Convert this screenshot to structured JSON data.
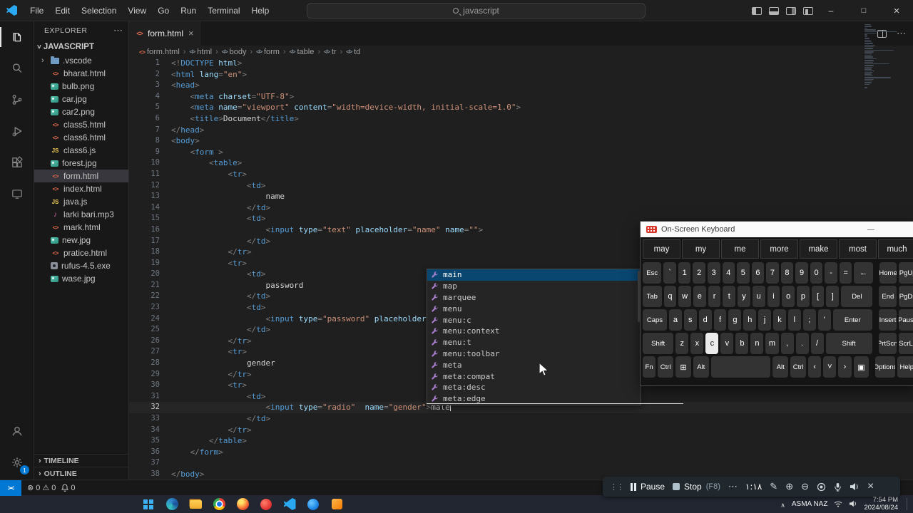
{
  "titlebar": {
    "menus": [
      "File",
      "Edit",
      "Selection",
      "View",
      "Go",
      "Run",
      "Terminal",
      "Help"
    ],
    "search": "javascript"
  },
  "activity_bar": {
    "settings_badge": "1"
  },
  "explorer": {
    "title": "EXPLORER",
    "root": "JAVASCRIPT",
    "files": [
      {
        "name": ".vscode",
        "type": "folder"
      },
      {
        "name": "bharat.html",
        "type": "html"
      },
      {
        "name": "bulb.png",
        "type": "img"
      },
      {
        "name": "car.jpg",
        "type": "img"
      },
      {
        "name": "car2.png",
        "type": "img"
      },
      {
        "name": "class5.html",
        "type": "html"
      },
      {
        "name": "class6.html",
        "type": "html"
      },
      {
        "name": "class6.js",
        "type": "js"
      },
      {
        "name": "forest.jpg",
        "type": "img"
      },
      {
        "name": "form.html",
        "type": "html",
        "selected": true
      },
      {
        "name": "index.html",
        "type": "html"
      },
      {
        "name": "java.js",
        "type": "js"
      },
      {
        "name": "larki bari.mp3",
        "type": "audio"
      },
      {
        "name": "mark.html",
        "type": "html"
      },
      {
        "name": "new.jpg",
        "type": "img"
      },
      {
        "name": "pratice.html",
        "type": "html"
      },
      {
        "name": "rufus-4.5.exe",
        "type": "exe"
      },
      {
        "name": "wase.jpg",
        "type": "img"
      }
    ],
    "sections": [
      "TIMELINE",
      "OUTLINE"
    ]
  },
  "tab": {
    "name": "form.html"
  },
  "breadcrumb": [
    "form.html",
    "html",
    "body",
    "form",
    "table",
    "tr",
    "td"
  ],
  "code": {
    "start_line": 1,
    "cursor_line": 32,
    "lines": [
      [
        [
          "p",
          "<!"
        ],
        [
          "t",
          "DOCTYPE"
        ],
        [
          "a",
          " html"
        ],
        [
          "p",
          ">"
        ]
      ],
      [
        [
          "p",
          "<"
        ],
        [
          "t",
          "html"
        ],
        [
          "a",
          " lang"
        ],
        [
          "p",
          "="
        ],
        [
          "s",
          "\"en\""
        ],
        [
          "p",
          ">"
        ]
      ],
      [
        [
          "p",
          "<"
        ],
        [
          "t",
          "head"
        ],
        [
          "p",
          ">"
        ]
      ],
      [
        [
          "x",
          "    "
        ],
        [
          "p",
          "<"
        ],
        [
          "t",
          "meta"
        ],
        [
          "a",
          " charset"
        ],
        [
          "p",
          "="
        ],
        [
          "s",
          "\"UTF-8\""
        ],
        [
          "p",
          ">"
        ]
      ],
      [
        [
          "x",
          "    "
        ],
        [
          "p",
          "<"
        ],
        [
          "t",
          "meta"
        ],
        [
          "a",
          " name"
        ],
        [
          "p",
          "="
        ],
        [
          "s",
          "\"viewport\""
        ],
        [
          "a",
          " content"
        ],
        [
          "p",
          "="
        ],
        [
          "s",
          "\"width=device-width, initial-scale=1.0\""
        ],
        [
          "p",
          ">"
        ]
      ],
      [
        [
          "x",
          "    "
        ],
        [
          "p",
          "<"
        ],
        [
          "t",
          "title"
        ],
        [
          "p",
          ">"
        ],
        [
          "x",
          "Document"
        ],
        [
          "p",
          "</"
        ],
        [
          "t",
          "title"
        ],
        [
          "p",
          ">"
        ]
      ],
      [
        [
          "p",
          "</"
        ],
        [
          "t",
          "head"
        ],
        [
          "p",
          ">"
        ]
      ],
      [
        [
          "p",
          "<"
        ],
        [
          "t",
          "body"
        ],
        [
          "p",
          ">"
        ]
      ],
      [
        [
          "x",
          "    "
        ],
        [
          "p",
          "<"
        ],
        [
          "t",
          "form"
        ],
        [
          "x",
          " "
        ],
        [
          "p",
          ">"
        ]
      ],
      [
        [
          "x",
          "        "
        ],
        [
          "p",
          "<"
        ],
        [
          "t",
          "table"
        ],
        [
          "p",
          ">"
        ]
      ],
      [
        [
          "x",
          "            "
        ],
        [
          "p",
          "<"
        ],
        [
          "t",
          "tr"
        ],
        [
          "p",
          ">"
        ]
      ],
      [
        [
          "x",
          "                "
        ],
        [
          "p",
          "<"
        ],
        [
          "t",
          "td"
        ],
        [
          "p",
          ">"
        ]
      ],
      [
        [
          "x",
          "                    name"
        ]
      ],
      [
        [
          "x",
          "                "
        ],
        [
          "p",
          "</"
        ],
        [
          "t",
          "td"
        ],
        [
          "p",
          ">"
        ]
      ],
      [
        [
          "x",
          "                "
        ],
        [
          "p",
          "<"
        ],
        [
          "t",
          "td"
        ],
        [
          "p",
          ">"
        ]
      ],
      [
        [
          "x",
          "                    "
        ],
        [
          "p",
          "<"
        ],
        [
          "t",
          "input"
        ],
        [
          "a",
          " type"
        ],
        [
          "p",
          "="
        ],
        [
          "s",
          "\"text\""
        ],
        [
          "a",
          " placeholder"
        ],
        [
          "p",
          "="
        ],
        [
          "s",
          "\"name\""
        ],
        [
          "a",
          " name"
        ],
        [
          "p",
          "="
        ],
        [
          "s",
          "\"\""
        ],
        [
          "p",
          ">"
        ]
      ],
      [
        [
          "x",
          "                "
        ],
        [
          "p",
          "</"
        ],
        [
          "t",
          "td"
        ],
        [
          "p",
          ">"
        ]
      ],
      [
        [
          "x",
          "            "
        ],
        [
          "p",
          "</"
        ],
        [
          "t",
          "tr"
        ],
        [
          "p",
          ">"
        ]
      ],
      [
        [
          "x",
          "            "
        ],
        [
          "p",
          "<"
        ],
        [
          "t",
          "tr"
        ],
        [
          "p",
          ">"
        ]
      ],
      [
        [
          "x",
          "                "
        ],
        [
          "p",
          "<"
        ],
        [
          "t",
          "td"
        ],
        [
          "p",
          ">"
        ]
      ],
      [
        [
          "x",
          "                    password"
        ]
      ],
      [
        [
          "x",
          "                "
        ],
        [
          "p",
          "</"
        ],
        [
          "t",
          "td"
        ],
        [
          "p",
          ">"
        ]
      ],
      [
        [
          "x",
          "                "
        ],
        [
          "p",
          "<"
        ],
        [
          "t",
          "td"
        ],
        [
          "p",
          ">"
        ]
      ],
      [
        [
          "x",
          "                    "
        ],
        [
          "p",
          "<"
        ],
        [
          "t",
          "input"
        ],
        [
          "a",
          " type"
        ],
        [
          "p",
          "="
        ],
        [
          "s",
          "\"password\""
        ],
        [
          "a",
          " placeholder"
        ],
        [
          "p",
          "="
        ],
        [
          "s",
          "\""
        ]
      ],
      [
        [
          "x",
          "                "
        ],
        [
          "p",
          "</"
        ],
        [
          "t",
          "td"
        ],
        [
          "p",
          ">"
        ]
      ],
      [
        [
          "x",
          "            "
        ],
        [
          "p",
          "</"
        ],
        [
          "t",
          "tr"
        ],
        [
          "p",
          ">"
        ]
      ],
      [
        [
          "x",
          "            "
        ],
        [
          "p",
          "<"
        ],
        [
          "t",
          "tr"
        ],
        [
          "p",
          ">"
        ]
      ],
      [
        [
          "x",
          "                gender"
        ]
      ],
      [
        [
          "x",
          "            "
        ],
        [
          "p",
          "</"
        ],
        [
          "t",
          "tr"
        ],
        [
          "p",
          ">"
        ]
      ],
      [
        [
          "x",
          "            "
        ],
        [
          "p",
          "<"
        ],
        [
          "t",
          "tr"
        ],
        [
          "p",
          ">"
        ]
      ],
      [
        [
          "x",
          "                "
        ],
        [
          "p",
          "<"
        ],
        [
          "t",
          "td"
        ],
        [
          "p",
          ">"
        ]
      ],
      [
        [
          "x",
          "                    "
        ],
        [
          "p",
          "<"
        ],
        [
          "t",
          "input"
        ],
        [
          "a",
          " type"
        ],
        [
          "p",
          "="
        ],
        [
          "s",
          "\"radio\""
        ],
        [
          "a",
          "  name"
        ],
        [
          "p",
          "="
        ],
        [
          "s",
          "\"gender\""
        ],
        [
          "p",
          ">"
        ],
        [
          "x",
          "male"
        ]
      ],
      [
        [
          "x",
          "                "
        ],
        [
          "p",
          "</"
        ],
        [
          "t",
          "td"
        ],
        [
          "p",
          ">"
        ]
      ],
      [
        [
          "x",
          "            "
        ],
        [
          "p",
          "</"
        ],
        [
          "t",
          "tr"
        ],
        [
          "p",
          ">"
        ]
      ],
      [
        [
          "x",
          "        "
        ],
        [
          "p",
          "</"
        ],
        [
          "t",
          "table"
        ],
        [
          "p",
          ">"
        ]
      ],
      [
        [
          "x",
          "    "
        ],
        [
          "p",
          "</"
        ],
        [
          "t",
          "form"
        ],
        [
          "p",
          ">"
        ]
      ],
      [],
      [
        [
          "p",
          "</"
        ],
        [
          "t",
          "body"
        ],
        [
          "p",
          ">"
        ]
      ]
    ]
  },
  "suggest": {
    "selected": 0,
    "items": [
      "main",
      "map",
      "marquee",
      "menu",
      "menu:c",
      "menu:context",
      "menu:t",
      "menu:toolbar",
      "meta",
      "meta:compat",
      "meta:desc",
      "meta:edge"
    ]
  },
  "osk": {
    "title": "On-Screen Keyboard",
    "suggestions": [
      "may",
      "my",
      "me",
      "more",
      "make",
      "most",
      "much"
    ],
    "rows": [
      [
        [
          "Esc",
          1.5
        ],
        [
          "`",
          1
        ],
        [
          "1",
          1
        ],
        [
          "2",
          1
        ],
        [
          "3",
          1
        ],
        [
          "4",
          1
        ],
        [
          "5",
          1
        ],
        [
          "6",
          1
        ],
        [
          "7",
          1
        ],
        [
          "8",
          1
        ],
        [
          "9",
          1
        ],
        [
          "0",
          1
        ],
        [
          "-",
          1
        ],
        [
          "=",
          1
        ],
        [
          "←",
          1.5
        ],
        [
          "Home",
          1.4,
          "g"
        ],
        [
          "PgUp",
          1.4
        ]
      ],
      [
        [
          "Tab",
          1.5
        ],
        [
          "q",
          1
        ],
        [
          "w",
          1
        ],
        [
          "e",
          1
        ],
        [
          "r",
          1
        ],
        [
          "t",
          1
        ],
        [
          "y",
          1
        ],
        [
          "u",
          1
        ],
        [
          "i",
          1
        ],
        [
          "o",
          1
        ],
        [
          "p",
          1
        ],
        [
          "[",
          1
        ],
        [
          "]",
          1
        ],
        [
          "Del",
          2.5
        ],
        [
          "End",
          1.4,
          "g"
        ],
        [
          "PgDn",
          1.4
        ]
      ],
      [
        [
          "Caps",
          1.9
        ],
        [
          "a",
          1
        ],
        [
          "s",
          1
        ],
        [
          "d",
          1
        ],
        [
          "f",
          1
        ],
        [
          "g",
          1
        ],
        [
          "h",
          1
        ],
        [
          "j",
          1
        ],
        [
          "k",
          1
        ],
        [
          "l",
          1
        ],
        [
          ";",
          1
        ],
        [
          "'",
          1
        ],
        [
          "Enter",
          3.1
        ],
        [
          "Insert",
          1.4,
          "g"
        ],
        [
          "Pause",
          1.4
        ]
      ],
      [
        [
          "Shift",
          2.4
        ],
        [
          "z",
          1
        ],
        [
          "x",
          1
        ],
        [
          "c",
          1,
          "p"
        ],
        [
          "v",
          1
        ],
        [
          "b",
          1
        ],
        [
          "n",
          1
        ],
        [
          "m",
          1
        ],
        [
          ",",
          1
        ],
        [
          ".",
          1
        ],
        [
          "/",
          1
        ],
        [
          "Shift",
          3.6
        ],
        [
          "PrtScn",
          1.4,
          "g"
        ],
        [
          "ScrLk",
          1.4
        ]
      ],
      [
        [
          "Fn",
          1
        ],
        [
          "Ctrl",
          1.2
        ],
        [
          "⊞",
          1.2
        ],
        [
          "Alt",
          1.2
        ],
        [
          "",
          4.6
        ],
        [
          "Alt",
          1.2
        ],
        [
          "Ctrl",
          1.2
        ],
        [
          "‹",
          1
        ],
        [
          "˅",
          1
        ],
        [
          "›",
          1
        ],
        [
          "▣",
          1.2
        ],
        [
          "Options",
          1.5,
          "g"
        ],
        [
          "Help",
          1.5
        ]
      ]
    ]
  },
  "recorder": {
    "pause": "Pause",
    "stop": "Stop",
    "stop_key": "(F8)",
    "time": "١:١٨"
  },
  "status_bar": {
    "errors": "0",
    "warnings": "0",
    "bell": "0"
  },
  "taskbar": {
    "icons": [
      "windows",
      "edge",
      "file-explorer",
      "chrome",
      "firefox",
      "app-red",
      "vscode",
      "app-blue",
      "app-orange"
    ],
    "tray_name": "ASMA NAZ",
    "time": "7:54 PM",
    "date": "2024/08/24"
  }
}
